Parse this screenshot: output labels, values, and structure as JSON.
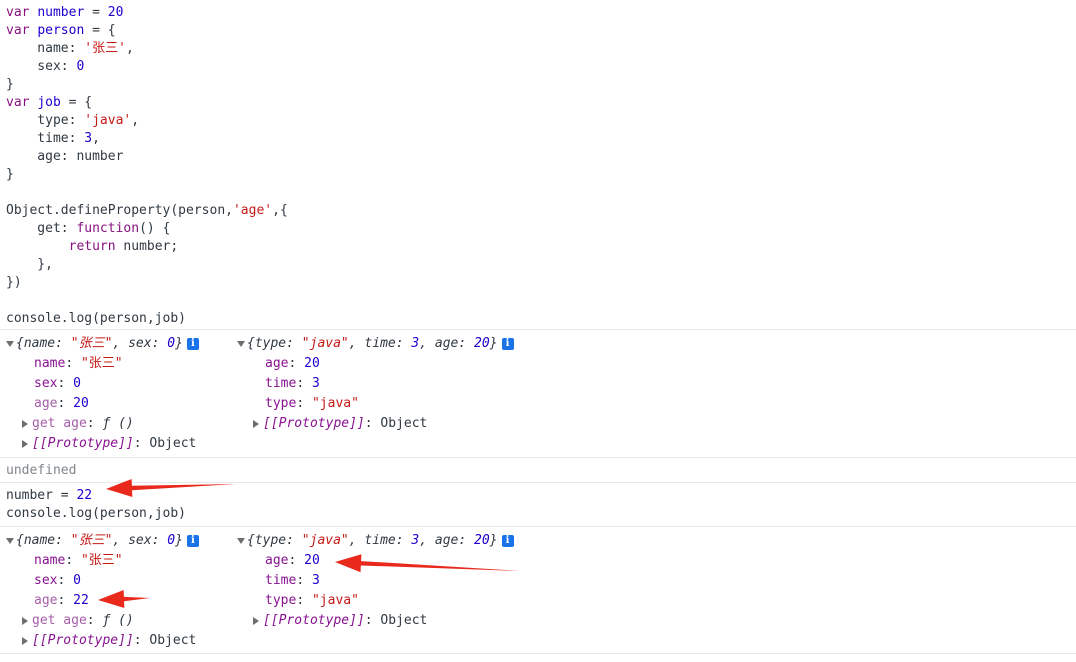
{
  "code_block": [
    [
      [
        "kw",
        "var"
      ],
      [
        "plain",
        " "
      ],
      [
        "vn",
        "number"
      ],
      [
        "plain",
        " = "
      ],
      [
        "num",
        "20"
      ]
    ],
    [
      [
        "kw",
        "var"
      ],
      [
        "plain",
        " "
      ],
      [
        "vn",
        "person"
      ],
      [
        "plain",
        " = {"
      ]
    ],
    [
      [
        "plain",
        "    name: "
      ],
      [
        "str",
        "'张三'"
      ],
      [
        "plain",
        ","
      ]
    ],
    [
      [
        "plain",
        "    sex: "
      ],
      [
        "num",
        "0"
      ]
    ],
    [
      [
        "plain",
        "}"
      ]
    ],
    [
      [
        "kw",
        "var"
      ],
      [
        "plain",
        " "
      ],
      [
        "vn",
        "job"
      ],
      [
        "plain",
        " = {"
      ]
    ],
    [
      [
        "plain",
        "    type: "
      ],
      [
        "str",
        "'java'"
      ],
      [
        "plain",
        ","
      ]
    ],
    [
      [
        "plain",
        "    time: "
      ],
      [
        "num",
        "3"
      ],
      [
        "plain",
        ","
      ]
    ],
    [
      [
        "plain",
        "    age: number"
      ]
    ],
    [
      [
        "plain",
        "}"
      ]
    ],
    [
      [
        "plain",
        ""
      ]
    ],
    [
      [
        "plain",
        "Object.defineProperty(person,"
      ],
      [
        "str",
        "'age'"
      ],
      [
        "plain",
        ",{"
      ]
    ],
    [
      [
        "plain",
        "    get: "
      ],
      [
        "kw",
        "function"
      ],
      [
        "plain",
        "() {"
      ]
    ],
    [
      [
        "plain",
        "        "
      ],
      [
        "kw",
        "return"
      ],
      [
        "plain",
        " number;"
      ]
    ],
    [
      [
        "plain",
        "    },"
      ]
    ],
    [
      [
        "plain",
        "})"
      ]
    ],
    [
      [
        "plain",
        ""
      ]
    ],
    [
      [
        "plain",
        "console.log(person,job)"
      ]
    ]
  ],
  "log1": {
    "person_preview": [
      [
        "it",
        "{"
      ],
      [
        "itk",
        "name"
      ],
      [
        "it",
        ": "
      ],
      [
        "its",
        "\"张三\""
      ],
      [
        "it",
        ", "
      ],
      [
        "itk",
        "sex"
      ],
      [
        "it",
        ": "
      ],
      [
        "itn",
        "0"
      ],
      [
        "it",
        "}"
      ]
    ],
    "job_preview": [
      [
        "it",
        "{"
      ],
      [
        "itk",
        "type"
      ],
      [
        "it",
        ": "
      ],
      [
        "its",
        "\"java\""
      ],
      [
        "it",
        ", "
      ],
      [
        "itk",
        "time"
      ],
      [
        "it",
        ": "
      ],
      [
        "itn",
        "3"
      ],
      [
        "it",
        ", "
      ],
      [
        "itk",
        "age"
      ],
      [
        "it",
        ": "
      ],
      [
        "itn",
        "20"
      ],
      [
        "it",
        "}"
      ]
    ],
    "person_props": [
      {
        "key": "name",
        "val": "\"张三\"",
        "vt": "str"
      },
      {
        "key": "sex",
        "val": "0",
        "vt": "num"
      },
      {
        "key": "age",
        "val": "20",
        "vt": "num",
        "dim": true
      },
      {
        "key": "get age",
        "val": "ƒ ()",
        "vt": "fn",
        "expand": true,
        "dim": true
      },
      {
        "key": "[[Prototype]]",
        "val": "Object",
        "vt": "obj",
        "expand": true,
        "proto": true
      }
    ],
    "job_props": [
      {
        "key": "age",
        "val": "20",
        "vt": "num"
      },
      {
        "key": "time",
        "val": "3",
        "vt": "num"
      },
      {
        "key": "type",
        "val": "\"java\"",
        "vt": "str"
      },
      {
        "key": "[[Prototype]]",
        "val": "Object",
        "vt": "obj",
        "expand": true,
        "proto": true
      }
    ]
  },
  "undefined_text": "undefined",
  "input2_line1": [
    [
      "plain",
      "number = "
    ],
    [
      "num",
      "22"
    ]
  ],
  "input2_line2": "console.log(person,job)",
  "log2": {
    "person_props": [
      {
        "key": "name",
        "val": "\"张三\"",
        "vt": "str"
      },
      {
        "key": "sex",
        "val": "0",
        "vt": "num"
      },
      {
        "key": "age",
        "val": "22",
        "vt": "num",
        "dim": true
      },
      {
        "key": "get age",
        "val": "ƒ ()",
        "vt": "fn",
        "expand": true,
        "dim": true
      },
      {
        "key": "[[Prototype]]",
        "val": "Object",
        "vt": "obj",
        "expand": true,
        "proto": true
      }
    ],
    "job_props": [
      {
        "key": "age",
        "val": "20",
        "vt": "num"
      },
      {
        "key": "time",
        "val": "3",
        "vt": "num"
      },
      {
        "key": "type",
        "val": "\"java\"",
        "vt": "str"
      },
      {
        "key": "[[Prototype]]",
        "val": "Object",
        "vt": "obj",
        "expand": true,
        "proto": true
      }
    ]
  },
  "info_glyph": "i",
  "annotation_color": "#e8291c"
}
